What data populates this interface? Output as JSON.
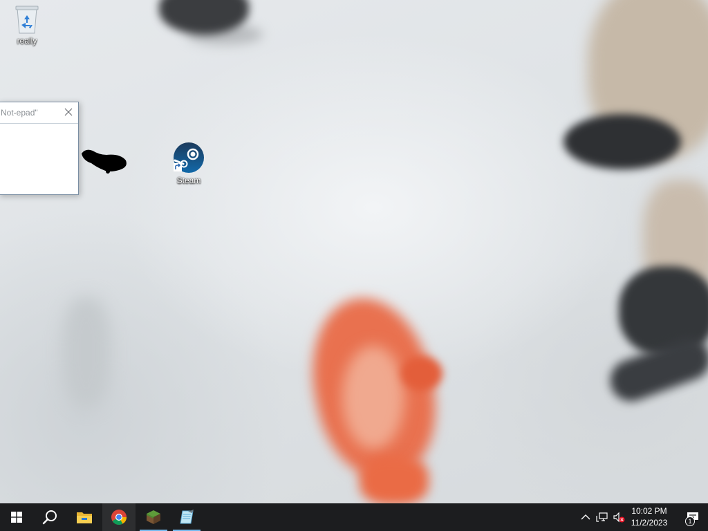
{
  "desktop": {
    "icons": [
      {
        "label": "really",
        "icon": "recycle-bin-icon"
      },
      {
        "label": "Steam",
        "icon": "steam-icon"
      }
    ]
  },
  "notepad_window": {
    "title": "Not-epad\""
  },
  "taskbar": {
    "apps": [
      "start-windows-icon",
      "search-icon",
      "file-explorer-icon",
      "chrome-icon",
      "minecraft-icon",
      "notepad-icon"
    ],
    "active_app": "chrome-icon",
    "clock_time": "10:02 PM",
    "clock_date": "11/2/2023",
    "notification_count": "1"
  },
  "colors": {
    "taskbar_bg": "#1c1d1f",
    "accent": "#76b9ed"
  }
}
